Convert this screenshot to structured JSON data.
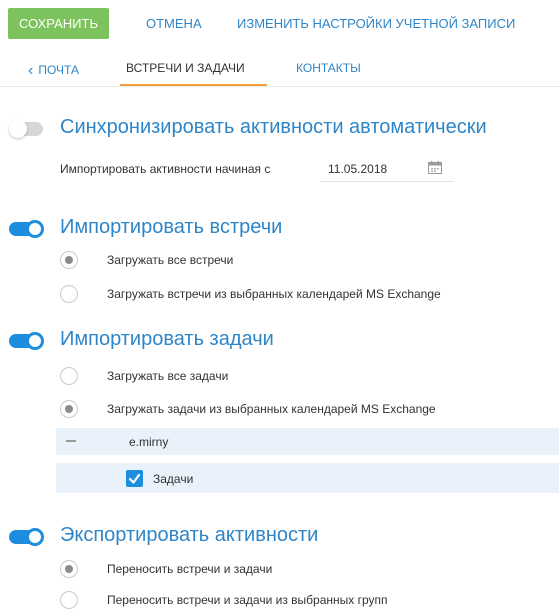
{
  "toolbar": {
    "save_label": "СОХРАНИТЬ",
    "cancel_label": "ОТМЕНА",
    "account_settings_label": "ИЗМЕНИТЬ НАСТРОЙКИ УЧЕТНОЙ ЗАПИСИ"
  },
  "tabs": {
    "back_glyph": "‹",
    "mail": "ПОЧТА",
    "meetings_tasks": "ВСТРЕЧИ И ЗАДАЧИ",
    "contacts": "КОНТАКТЫ"
  },
  "sync": {
    "enabled": false,
    "title": "Синхронизировать активности автоматически",
    "import_from_label": "Импортировать активности начиная с",
    "import_from_date": "11.05.2018"
  },
  "import_meetings": {
    "enabled": true,
    "title": "Импортировать встречи",
    "options": [
      "Загружать все встречи",
      "Загружать встречи из выбранных календарей MS Exchange"
    ],
    "selected_index": 0
  },
  "import_tasks": {
    "enabled": true,
    "title": "Импортировать задачи",
    "options": [
      "Загружать все задачи",
      "Загружать задачи из выбранных календарей MS Exchange"
    ],
    "selected_index": 1,
    "tree": {
      "account": "e.mirny",
      "folder": "Задачи",
      "folder_checked": true
    }
  },
  "export_activities": {
    "enabled": true,
    "title": "Экспортировать активности",
    "options": [
      "Переносить встречи и задачи",
      "Переносить встречи и задачи из выбранных групп"
    ],
    "selected_index": 0
  },
  "colors": {
    "accent_blue": "#2e86c8",
    "toggle_blue": "#1d8ede",
    "save_green": "#7cc35d",
    "tab_active_underline": "#f2a03c",
    "tree_highlight": "#e9f1fb"
  },
  "icons": [
    "chevron-left-icon",
    "calendar-icon",
    "collapse-dash-icon",
    "checkmark-icon"
  ]
}
